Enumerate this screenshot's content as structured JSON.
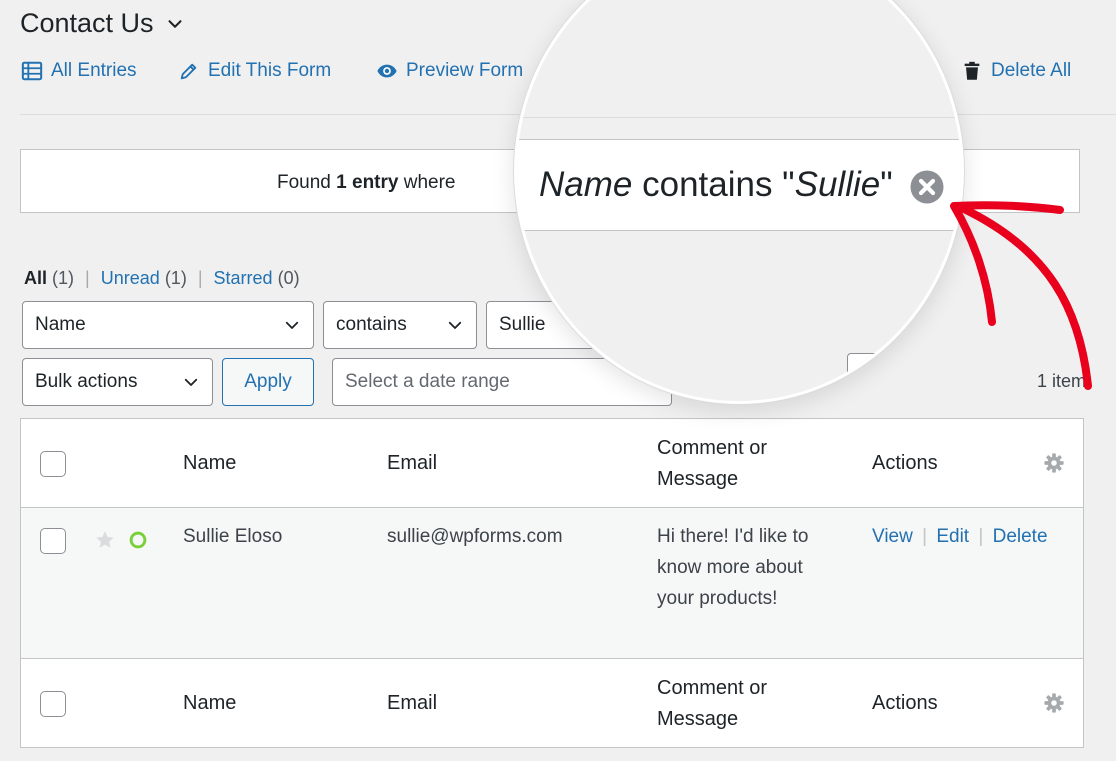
{
  "header": {
    "title": "Contact Us",
    "nav": {
      "all_entries": "All Entries",
      "edit_form": "Edit This Form",
      "preview_form": "Preview Form",
      "delete_all": "Delete All"
    }
  },
  "notice": {
    "prefix": "Found ",
    "count_text": "1 entry",
    "suffix": " where"
  },
  "magnifier": {
    "field": "Name",
    "mid": " contains \"",
    "value": "Sullie",
    "end": "\""
  },
  "views": {
    "all_label": "All",
    "all_count": "(1)",
    "unread_label": "Unread",
    "unread_count": "(1)",
    "starred_label": "Starred",
    "starred_count": "(0)",
    "separator": "|"
  },
  "filters": {
    "field_select": "Name",
    "operator_select": "contains",
    "search_value": "Sullie",
    "bulk_actions": "Bulk actions",
    "apply": "Apply",
    "date_placeholder": "Select a date range",
    "items_count": "1 item"
  },
  "table": {
    "columns": {
      "name": "Name",
      "email": "Email",
      "message": "Comment or Message",
      "actions": "Actions"
    },
    "rows": [
      {
        "name": "Sullie Eloso",
        "email": "sullie@wpforms.com",
        "message": "Hi there! I'd like to know more about your products!",
        "actions": {
          "view": "View",
          "edit": "Edit",
          "delete": "Delete",
          "separator": "|"
        }
      }
    ]
  },
  "colors": {
    "link": "#2271b1",
    "background": "#f0f0f1",
    "annotation_arrow": "#e8001c",
    "read_status": "#7ad03a"
  },
  "icons": {
    "all_entries": "table-list-icon",
    "edit_form": "pencil-icon",
    "preview_form": "eye-icon",
    "delete_all": "trash-icon",
    "title_menu": "chevron-down-icon",
    "remove_filter": "circle-x-icon",
    "star": "star-icon",
    "status": "read-status-icon",
    "column_settings": "gear-icon"
  }
}
